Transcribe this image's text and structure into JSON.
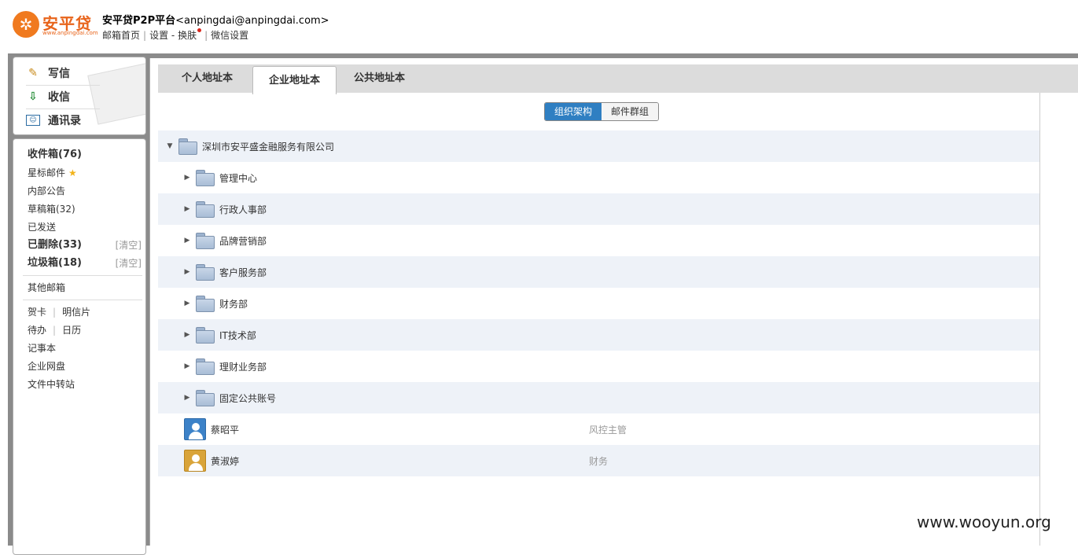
{
  "header": {
    "logo_text": "安平贷",
    "logo_sub": "www.anpingdai.com",
    "account_name": "安平贷P2P平台",
    "account_email": "<anpingdai@anpingdai.com>",
    "links": {
      "home": "邮箱首页",
      "settings": "设置",
      "dash": "-",
      "skin": "换肤",
      "wechat": "微信设置"
    }
  },
  "quick": {
    "write": "写信",
    "receive": "收信",
    "contacts": "通讯录"
  },
  "nav": {
    "inbox": "收件箱(76)",
    "starred": "星标邮件",
    "notice": "内部公告",
    "drafts": "草稿箱(32)",
    "sent": "已发送",
    "deleted": "已删除(33)",
    "trash": "垃圾箱(18)",
    "clear": "[清空]",
    "other": "其他邮箱",
    "card": "贺卡",
    "postcard": "明信片",
    "todo": "待办",
    "calendar": "日历",
    "notes": "记事本",
    "disk": "企业网盘",
    "transfer": "文件中转站"
  },
  "tabs": {
    "personal": "个人地址本",
    "enterprise": "企业地址本",
    "public": "公共地址本"
  },
  "segment": {
    "org": "组织架构",
    "groups": "邮件群组"
  },
  "tree": {
    "root": "深圳市安平盛金融服务有限公司",
    "departments": [
      "管理中心",
      "行政人事部",
      "品牌营销部",
      "客户服务部",
      "财务部",
      "IT技术部",
      "理财业务部",
      "固定公共账号"
    ],
    "contacts": [
      {
        "name": "蔡昭平",
        "title": "风控主管",
        "avatar_color": "#3c82c8"
      },
      {
        "name": "黄淑婷",
        "title": "财务",
        "avatar_color": "#d9a43a"
      }
    ]
  },
  "watermark": "www.wooyun.org"
}
